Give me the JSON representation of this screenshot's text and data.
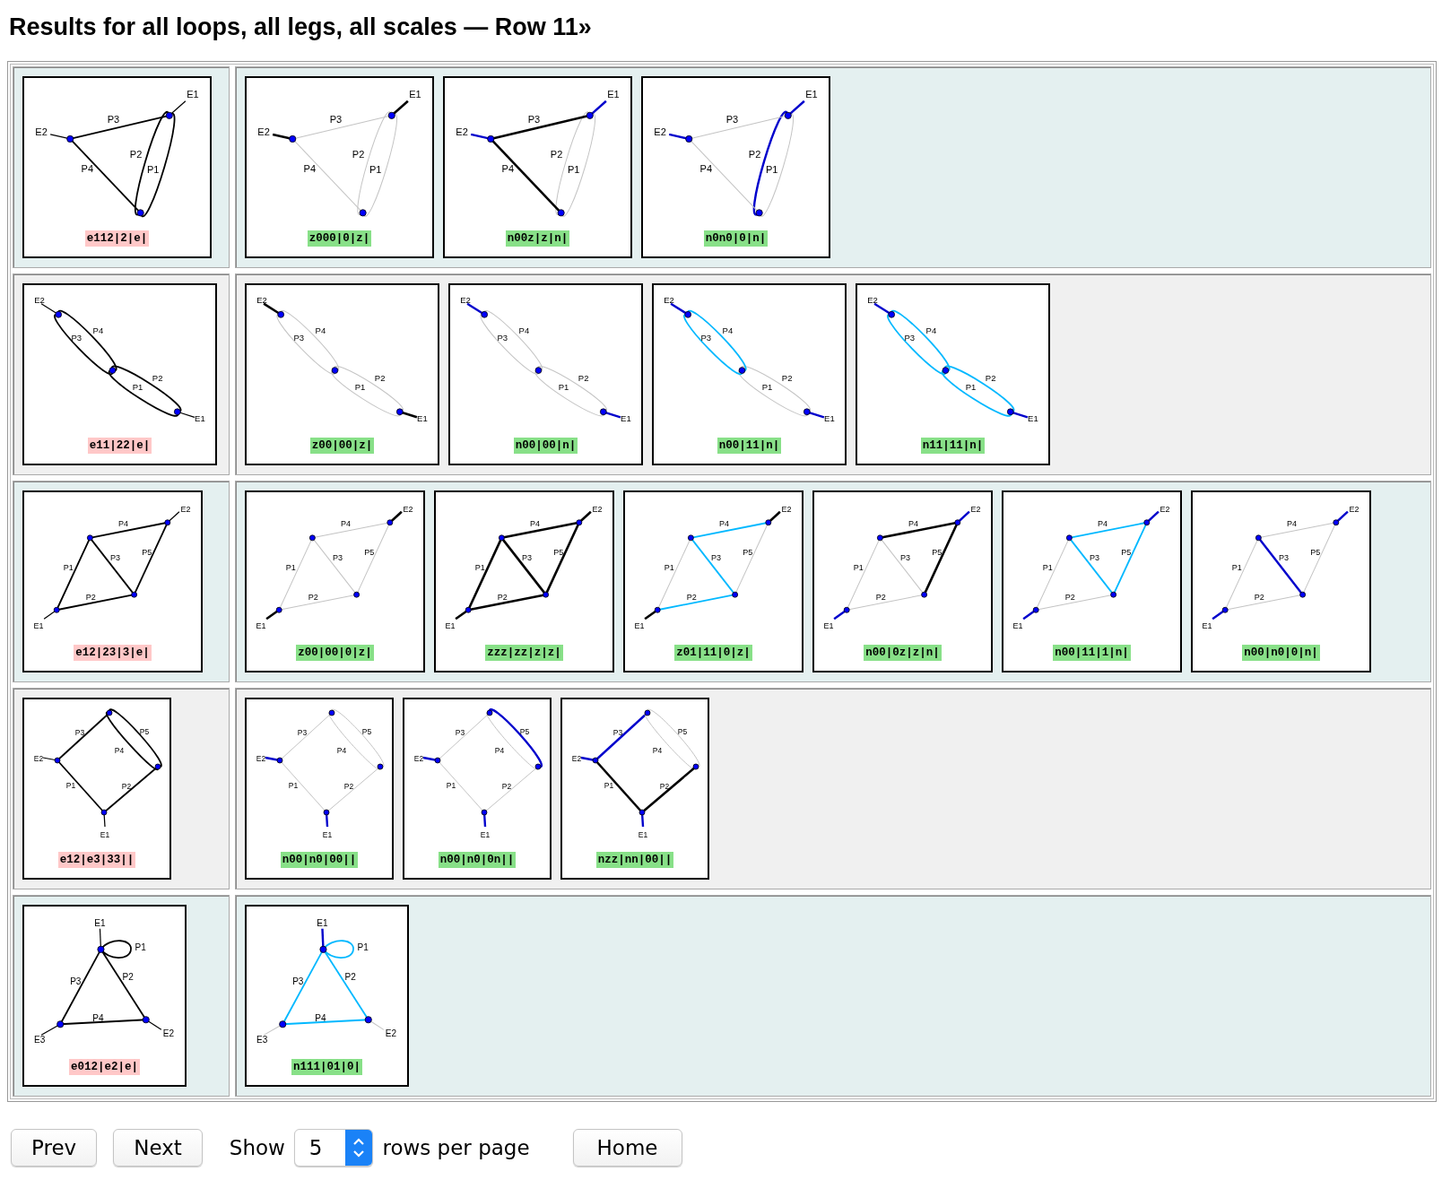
{
  "title": "Results for all loops, all legs, all scales — Row 11»",
  "rows": [
    {
      "kind": "triangle_bubble",
      "main": {
        "label": "e112|2|e|",
        "edges": [
          {
            "label": "P1",
            "kind": "plain"
          },
          {
            "label": "P2",
            "kind": "plain"
          },
          {
            "label": "P3",
            "kind": "plain"
          },
          {
            "label": "P4",
            "kind": "plain"
          }
        ],
        "legs": [
          {
            "label": "E1",
            "kind": "thin"
          },
          {
            "label": "E2",
            "kind": "thin"
          }
        ]
      },
      "variants": [
        {
          "label": "z000|0|z|",
          "edges": [
            {
              "label": "P1",
              "kind": "dim"
            },
            {
              "label": "P2",
              "kind": "dim"
            },
            {
              "label": "P3",
              "kind": "dim"
            },
            {
              "label": "P4",
              "kind": "dim"
            }
          ],
          "legs": [
            {
              "label": "E1",
              "kind": "heavy"
            },
            {
              "label": "E2",
              "kind": "heavy"
            }
          ]
        },
        {
          "label": "n00z|z|n|",
          "edges": [
            {
              "label": "P1",
              "kind": "dim"
            },
            {
              "label": "P2",
              "kind": "dim"
            },
            {
              "label": "P3",
              "kind": "heavy"
            },
            {
              "label": "P4",
              "kind": "heavy"
            }
          ],
          "legs": [
            {
              "label": "E1",
              "kind": "blue"
            },
            {
              "label": "E2",
              "kind": "blue"
            }
          ]
        },
        {
          "label": "n0n0|0|n|",
          "edges": [
            {
              "label": "P1",
              "kind": "dim"
            },
            {
              "label": "P2",
              "kind": "blue"
            },
            {
              "label": "P3",
              "kind": "dim"
            },
            {
              "label": "P4",
              "kind": "dim"
            }
          ],
          "legs": [
            {
              "label": "E1",
              "kind": "blue"
            },
            {
              "label": "E2",
              "kind": "blue"
            }
          ]
        }
      ]
    },
    {
      "kind": "chain_bubbles",
      "main": {
        "label": "e11|22|e|",
        "edges": [
          {
            "label": "P1",
            "kind": "plain"
          },
          {
            "label": "P2",
            "kind": "plain"
          },
          {
            "label": "P3",
            "kind": "plain"
          },
          {
            "label": "P4",
            "kind": "plain"
          }
        ],
        "legs": [
          {
            "label": "E1",
            "kind": "thin"
          },
          {
            "label": "E2",
            "kind": "thin"
          }
        ]
      },
      "variants": [
        {
          "label": "z00|00|z|",
          "edges": [
            {
              "label": "P1",
              "kind": "dim"
            },
            {
              "label": "P2",
              "kind": "dim"
            },
            {
              "label": "P3",
              "kind": "dim"
            },
            {
              "label": "P4",
              "kind": "dim"
            }
          ],
          "legs": [
            {
              "label": "E1",
              "kind": "heavy"
            },
            {
              "label": "E2",
              "kind": "heavy"
            }
          ]
        },
        {
          "label": "n00|00|n|",
          "edges": [
            {
              "label": "P1",
              "kind": "dim"
            },
            {
              "label": "P2",
              "kind": "dim"
            },
            {
              "label": "P3",
              "kind": "dim"
            },
            {
              "label": "P4",
              "kind": "dim"
            }
          ],
          "legs": [
            {
              "label": "E1",
              "kind": "blue"
            },
            {
              "label": "E2",
              "kind": "blue"
            }
          ]
        },
        {
          "label": "n00|11|n|",
          "edges": [
            {
              "label": "P1",
              "kind": "dim"
            },
            {
              "label": "P2",
              "kind": "dim"
            },
            {
              "label": "P3",
              "kind": "cyan"
            },
            {
              "label": "P4",
              "kind": "cyan"
            }
          ],
          "legs": [
            {
              "label": "E1",
              "kind": "blue"
            },
            {
              "label": "E2",
              "kind": "blue"
            }
          ]
        },
        {
          "label": "n11|11|n|",
          "edges": [
            {
              "label": "P1",
              "kind": "cyan"
            },
            {
              "label": "P2",
              "kind": "cyan"
            },
            {
              "label": "P3",
              "kind": "cyan"
            },
            {
              "label": "P4",
              "kind": "cyan"
            }
          ],
          "legs": [
            {
              "label": "E1",
              "kind": "blue"
            },
            {
              "label": "E2",
              "kind": "blue"
            }
          ]
        }
      ]
    },
    {
      "kind": "kite",
      "main": {
        "label": "e12|23|3|e|",
        "edges": [
          {
            "label": "P1",
            "kind": "plain"
          },
          {
            "label": "P2",
            "kind": "plain"
          },
          {
            "label": "P3",
            "kind": "plain"
          },
          {
            "label": "P4",
            "kind": "plain"
          },
          {
            "label": "P5",
            "kind": "plain"
          }
        ],
        "legs": [
          {
            "label": "E1",
            "kind": "thin"
          },
          {
            "label": "E2",
            "kind": "thin"
          }
        ]
      },
      "variants": [
        {
          "label": "z00|00|0|z|",
          "edges": [
            {
              "label": "P1",
              "kind": "dim"
            },
            {
              "label": "P2",
              "kind": "dim"
            },
            {
              "label": "P3",
              "kind": "dim"
            },
            {
              "label": "P4",
              "kind": "dim"
            },
            {
              "label": "P5",
              "kind": "dim"
            }
          ],
          "legs": [
            {
              "label": "E1",
              "kind": "heavy"
            },
            {
              "label": "E2",
              "kind": "heavy"
            }
          ]
        },
        {
          "label": "zzz|zz|z|z|",
          "edges": [
            {
              "label": "P1",
              "kind": "heavy"
            },
            {
              "label": "P2",
              "kind": "heavy"
            },
            {
              "label": "P3",
              "kind": "heavy"
            },
            {
              "label": "P4",
              "kind": "heavy"
            },
            {
              "label": "P5",
              "kind": "heavy"
            }
          ],
          "legs": [
            {
              "label": "E1",
              "kind": "heavy"
            },
            {
              "label": "E2",
              "kind": "heavy"
            }
          ]
        },
        {
          "label": "z01|11|0|z|",
          "edges": [
            {
              "label": "P1",
              "kind": "dim"
            },
            {
              "label": "P2",
              "kind": "cyan"
            },
            {
              "label": "P3",
              "kind": "cyan"
            },
            {
              "label": "P4",
              "kind": "cyan"
            },
            {
              "label": "P5",
              "kind": "dim"
            }
          ],
          "legs": [
            {
              "label": "E1",
              "kind": "heavy"
            },
            {
              "label": "E2",
              "kind": "heavy"
            }
          ]
        },
        {
          "label": "n00|0z|z|n|",
          "edges": [
            {
              "label": "P1",
              "kind": "dim"
            },
            {
              "label": "P2",
              "kind": "dim"
            },
            {
              "label": "P3",
              "kind": "dim"
            },
            {
              "label": "P4",
              "kind": "heavy"
            },
            {
              "label": "P5",
              "kind": "heavy"
            }
          ],
          "legs": [
            {
              "label": "E1",
              "kind": "blue"
            },
            {
              "label": "E2",
              "kind": "blue"
            }
          ]
        },
        {
          "label": "n00|11|1|n|",
          "edges": [
            {
              "label": "P1",
              "kind": "dim"
            },
            {
              "label": "P2",
              "kind": "dim"
            },
            {
              "label": "P3",
              "kind": "cyan"
            },
            {
              "label": "P4",
              "kind": "cyan"
            },
            {
              "label": "P5",
              "kind": "cyan"
            }
          ],
          "legs": [
            {
              "label": "E1",
              "kind": "blue"
            },
            {
              "label": "E2",
              "kind": "blue"
            }
          ]
        },
        {
          "label": "n00|n0|0|n|",
          "edges": [
            {
              "label": "P1",
              "kind": "dim"
            },
            {
              "label": "P2",
              "kind": "dim"
            },
            {
              "label": "P3",
              "kind": "blue"
            },
            {
              "label": "P4",
              "kind": "dim"
            },
            {
              "label": "P5",
              "kind": "dim"
            }
          ],
          "legs": [
            {
              "label": "E1",
              "kind": "blue"
            },
            {
              "label": "E2",
              "kind": "blue"
            }
          ]
        }
      ]
    },
    {
      "kind": "square_bubble",
      "main": {
        "label": "e12|e3|33||",
        "edges": [
          {
            "label": "P3",
            "kind": "plain"
          },
          {
            "label": "P4",
            "kind": "plain"
          },
          {
            "label": "P5",
            "kind": "plain"
          },
          {
            "label": "P1",
            "kind": "plain"
          },
          {
            "label": "P2",
            "kind": "plain"
          }
        ],
        "legs": [
          {
            "label": "E2",
            "kind": "thin"
          },
          {
            "label": "E1",
            "kind": "thin"
          }
        ]
      },
      "variants": [
        {
          "label": "n00|n0|00||",
          "edges": [
            {
              "label": "P3",
              "kind": "dim"
            },
            {
              "label": "P4",
              "kind": "dim"
            },
            {
              "label": "P5",
              "kind": "dim"
            },
            {
              "label": "P1",
              "kind": "dim"
            },
            {
              "label": "P2",
              "kind": "dim"
            }
          ],
          "legs": [
            {
              "label": "E2",
              "kind": "blue"
            },
            {
              "label": "E1",
              "kind": "blue"
            }
          ]
        },
        {
          "label": "n00|n0|0n||",
          "edges": [
            {
              "label": "P3",
              "kind": "dim"
            },
            {
              "label": "P4",
              "kind": "dim"
            },
            {
              "label": "P5",
              "kind": "blue"
            },
            {
              "label": "P1",
              "kind": "dim"
            },
            {
              "label": "P2",
              "kind": "dim"
            }
          ],
          "legs": [
            {
              "label": "E2",
              "kind": "blue"
            },
            {
              "label": "E1",
              "kind": "blue"
            }
          ]
        },
        {
          "label": "nzz|nn|00||",
          "edges": [
            {
              "label": "P3",
              "kind": "blue"
            },
            {
              "label": "P4",
              "kind": "dim"
            },
            {
              "label": "P5",
              "kind": "dim"
            },
            {
              "label": "P1",
              "kind": "heavy"
            },
            {
              "label": "P2",
              "kind": "heavy"
            }
          ],
          "legs": [
            {
              "label": "E2",
              "kind": "blue"
            },
            {
              "label": "E1",
              "kind": "blue"
            }
          ]
        }
      ]
    },
    {
      "kind": "triangle_tadpole",
      "main": {
        "label": "e012|e2|e|",
        "edges": [
          {
            "label": "P1",
            "kind": "plain"
          },
          {
            "label": "P2",
            "kind": "plain"
          },
          {
            "label": "P3",
            "kind": "plain"
          },
          {
            "label": "P4",
            "kind": "plain"
          }
        ],
        "legs": [
          {
            "label": "E1",
            "kind": "thin"
          },
          {
            "label": "E2",
            "kind": "thin"
          },
          {
            "label": "E3",
            "kind": "thin"
          }
        ]
      },
      "variants": [
        {
          "label": "n111|01|0|",
          "edges": [
            {
              "label": "P1",
              "kind": "cyan"
            },
            {
              "label": "P2",
              "kind": "cyan"
            },
            {
              "label": "P3",
              "kind": "cyan"
            },
            {
              "label": "P4",
              "kind": "cyan"
            }
          ],
          "legs": [
            {
              "label": "E1",
              "kind": "blue"
            },
            {
              "label": "E2",
              "kind": "dim"
            },
            {
              "label": "E3",
              "kind": "dim"
            }
          ]
        }
      ]
    }
  ],
  "pager": {
    "prev": "Prev",
    "next": "Next",
    "show": "Show",
    "rows_per_page": "5",
    "suffix": "rows per page",
    "home": "Home"
  }
}
